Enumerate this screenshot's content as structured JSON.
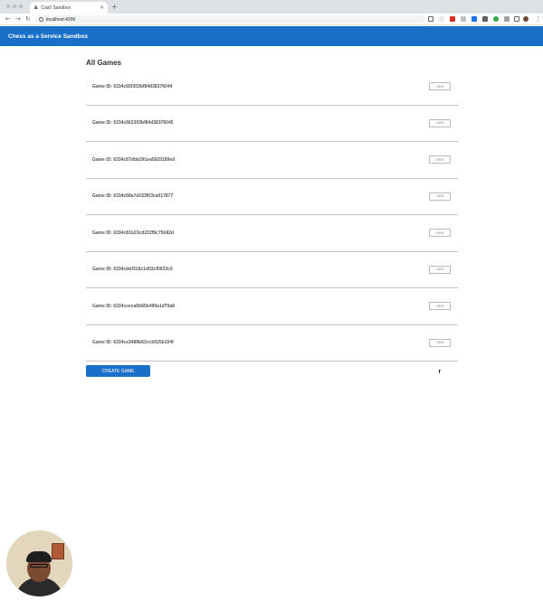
{
  "browser": {
    "tab_title": "Cas0 Sandbox",
    "url": "localhost:4200",
    "new_tab_glyph": "+",
    "close_glyph": "×"
  },
  "header": {
    "title": "Chess as a Service Sandbox"
  },
  "main": {
    "title": "All Games",
    "view_label": "VIEW",
    "create_label": "CREATE GAME",
    "games": [
      "Game ID: 6334c65f303bf84d38376044",
      "Game ID: 6334c663303bf84d38376045",
      "Game ID: 6334c67dbb291ea5920189ed",
      "Game ID: 6334c68a7d153f03ca017877",
      "Game ID: 6334c81b23cd222f9c75b82d",
      "Game ID: 6334cbbf316c1d03cf0033c0",
      "Game ID: 6334cceca5b65b490a1d79a8",
      "Game ID: 6334ce3489b62ccb025b104f"
    ]
  },
  "colors": {
    "primary": "#1a6fc9",
    "divider": "#c4c4c4"
  },
  "icons": {
    "back": "back-arrow-icon",
    "forward": "forward-arrow-icon",
    "reload": "reload-icon",
    "info": "info-icon",
    "menu": "kebab-menu-icon"
  }
}
